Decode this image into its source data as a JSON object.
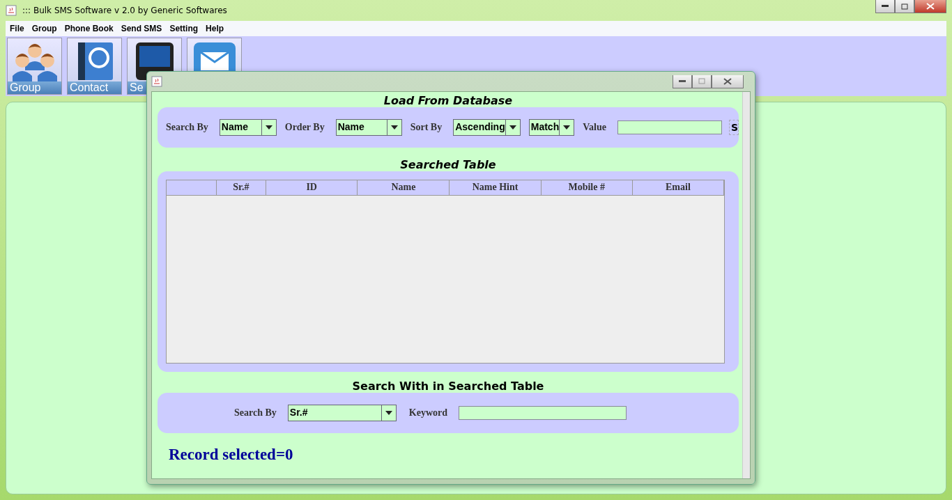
{
  "window": {
    "title": "::: Bulk SMS Software v 2.0 by Generic Softwares"
  },
  "menu": [
    "File",
    "Group",
    "Phone Book",
    "Send SMS",
    "Setting",
    "Help"
  ],
  "toolbar": [
    {
      "kind": "group",
      "label": "Group"
    },
    {
      "kind": "contact",
      "label": "Contact"
    },
    {
      "kind": "phone",
      "label": "Se"
    },
    {
      "kind": "mail"
    }
  ],
  "dialog": {
    "load": {
      "title": "Load From Database",
      "fields": [
        {
          "kind": "combo",
          "label": "Search By",
          "value": "Name"
        },
        {
          "kind": "combo",
          "label": "Order By",
          "value": "Name"
        },
        {
          "kind": "combo",
          "label": "Sort By",
          "value": "Ascending"
        },
        {
          "kind": "combo",
          "value": "Match"
        },
        {
          "kind": "text",
          "label": "Value"
        }
      ],
      "button": "S"
    },
    "table": {
      "title": "Searched Table",
      "columns": [
        "",
        "Sr.#",
        "ID",
        "Name",
        "Name Hint",
        "Mobile #",
        "Email"
      ]
    },
    "search": {
      "title": "Search With in Searched Table",
      "label": "Search By",
      "value": "Sr.#",
      "keyword_label": "Keyword"
    },
    "status": "Record selected=0"
  }
}
